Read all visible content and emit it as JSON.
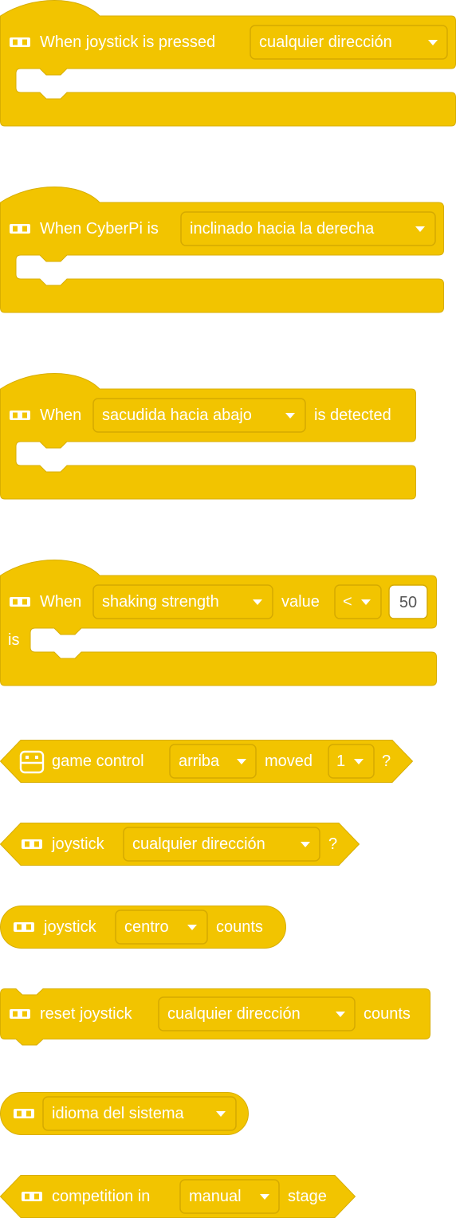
{
  "theme": {
    "block_color": "#F2C400",
    "border_color": "#D8AE00",
    "text_color": "#FFFFFF"
  },
  "blocks": [
    {
      "id": "when-joystick-pressed",
      "type": "hat",
      "icon": "cyberpi-icon",
      "label": "When joystick is pressed",
      "dropdown": "cualquier dirección"
    },
    {
      "id": "when-cyberpi-is",
      "type": "hat",
      "icon": "cyberpi-icon",
      "label": "When CyberPi is",
      "dropdown": "inclinado hacia la derecha"
    },
    {
      "id": "when-shake-detected",
      "type": "hat",
      "icon": "cyberpi-icon",
      "label": "When",
      "dropdown": "sacudida hacia abajo",
      "label2": "is detected"
    },
    {
      "id": "when-shaking-strength",
      "type": "hat",
      "icon": "cyberpi-icon",
      "label": "When",
      "dropdown": "shaking strength",
      "label2": "value",
      "operator": "<",
      "value": "50",
      "label3": "is"
    },
    {
      "id": "game-control-moved",
      "type": "boolean",
      "icon": "gamepad-icon",
      "label": "game control",
      "dropdown": "arriba",
      "label2": "moved",
      "dropdown2": "1",
      "label3": "?"
    },
    {
      "id": "joystick-direction",
      "type": "boolean",
      "icon": "cyberpi-icon",
      "label": "joystick",
      "dropdown": "cualquier dirección",
      "label2": "?"
    },
    {
      "id": "joystick-counts",
      "type": "reporter",
      "icon": "cyberpi-icon",
      "label": "joystick",
      "dropdown": "centro",
      "label2": "counts"
    },
    {
      "id": "reset-joystick-counts",
      "type": "command",
      "icon": "cyberpi-icon",
      "label": "reset joystick",
      "dropdown": "cualquier dirección",
      "label2": "counts"
    },
    {
      "id": "system-language",
      "type": "reporter",
      "icon": "cyberpi-icon",
      "dropdown": "idioma del sistema"
    },
    {
      "id": "competition-stage",
      "type": "boolean",
      "icon": "cyberpi-icon",
      "label": "competition in",
      "dropdown": "manual",
      "label2": "stage"
    }
  ]
}
